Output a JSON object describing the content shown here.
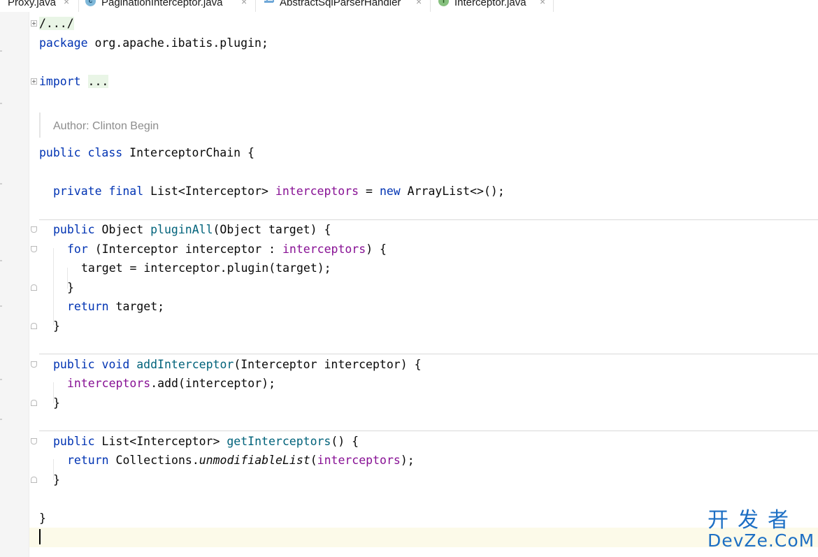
{
  "tabs": [
    {
      "label": "Proxy.java",
      "icon": "none",
      "active": false
    },
    {
      "label": "PaginationInterceptor.java",
      "icon": "class-icon",
      "icon_letter": "c",
      "active": false
    },
    {
      "label": "AbstractSqlParserHandler",
      "icon": "abstract-class-icon",
      "active": false
    },
    {
      "label": "Interceptor.java",
      "icon": "interface-icon",
      "icon_letter": "I",
      "active": true
    }
  ],
  "close_glyph": "×",
  "code": {
    "header_fold": "/.../",
    "package_kw": "package",
    "package_name": " org.apache.ibatis.plugin;",
    "import_kw": "import",
    "import_fold": "...",
    "doc_author": "Author: Clinton Begin",
    "class_decl": {
      "public": "public",
      "class": "class",
      "name": " InterceptorChain {"
    },
    "field": {
      "private": "private",
      "final": "final",
      "type": " List<Interceptor> ",
      "name": "interceptors",
      "eq": " = ",
      "new": "new",
      "init": " ArrayList<>();"
    },
    "plugin_all": {
      "sig_public": "public",
      "sig_type": " Object ",
      "sig_name": "pluginAll",
      "sig_params": "(Object target) {",
      "for_kw": "for",
      "for_open": " (Interceptor interceptor : ",
      "for_field": "interceptors",
      "for_close": ") {",
      "body": "target = interceptor.plugin(target);",
      "close_inner": "}",
      "return_kw": "return",
      "return_val": " target;",
      "close": "}"
    },
    "add_interceptor": {
      "sig_public": "public",
      "sig_void": "void",
      "sig_name": "addInterceptor",
      "sig_params": "(Interceptor interceptor) {",
      "body_field": "interceptors",
      "body_rest": ".add(interceptor);",
      "close": "}"
    },
    "get_interceptors": {
      "sig_public": "public",
      "sig_type": " List<Interceptor> ",
      "sig_name": "getInterceptors",
      "sig_params": "() {",
      "return_kw": "return",
      "return_cls": " Collections.",
      "return_mth": "unmodifiableList",
      "return_open": "(",
      "return_field": "interceptors",
      "return_close": ");",
      "close": "}"
    },
    "class_close": "}"
  },
  "watermark": {
    "cn": "开发者",
    "en": "DevZe.CoM"
  },
  "colors": {
    "keyword": "#0033b3",
    "field": "#871094",
    "method": "#00627a",
    "comment": "#8c8c8c",
    "watermark": "#1d6fc4"
  }
}
